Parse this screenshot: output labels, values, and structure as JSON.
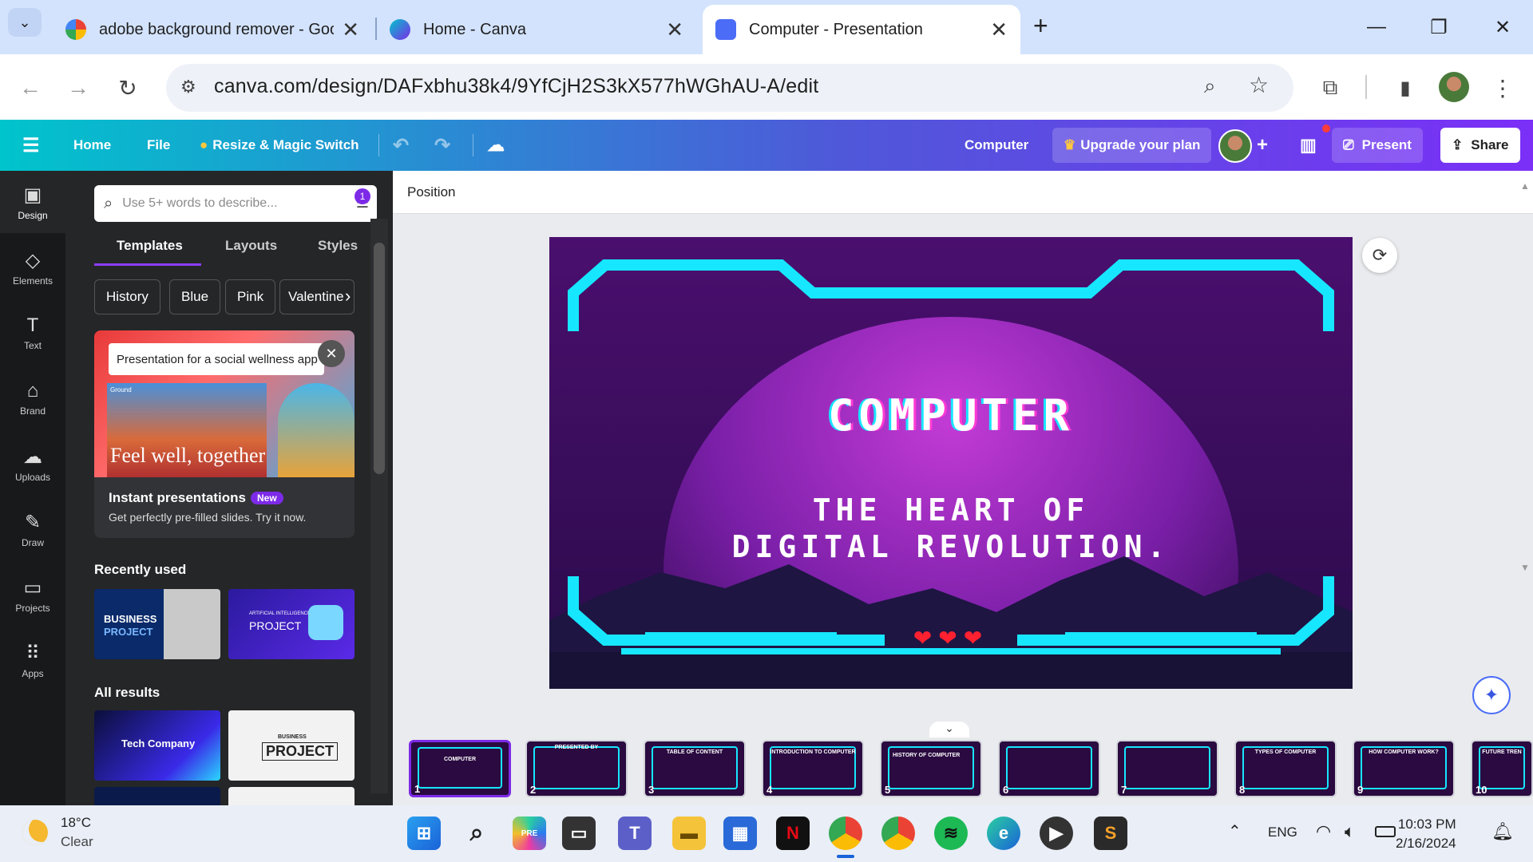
{
  "browser": {
    "tabs": [
      {
        "title": "adobe background remover - Goo",
        "icon": "google-icon",
        "active": false
      },
      {
        "title": "Home - Canva",
        "icon": "canva-icon",
        "active": false
      },
      {
        "title": "Computer - Presentation",
        "icon": "canva-presentation-icon",
        "active": true
      }
    ],
    "new_tab": "+",
    "url": "canva.com/design/DAFxbhu38k4/9YfCjH2S3kX577hWGhAU-A/edit"
  },
  "header": {
    "menu_icon": "hamburger-icon",
    "home": "Home",
    "file": "File",
    "resize": "Resize & Magic Switch",
    "doc_title": "Computer",
    "upgrade": "Upgrade your plan",
    "present": "Present",
    "share": "Share",
    "accent": "#7d2ae8"
  },
  "rail": [
    {
      "label": "Design",
      "icon": "design-icon"
    },
    {
      "label": "Elements",
      "icon": "elements-icon"
    },
    {
      "label": "Text",
      "icon": "text-icon"
    },
    {
      "label": "Brand",
      "icon": "brand-icon"
    },
    {
      "label": "Uploads",
      "icon": "uploads-icon"
    },
    {
      "label": "Draw",
      "icon": "draw-icon"
    },
    {
      "label": "Projects",
      "icon": "projects-icon"
    },
    {
      "label": "Apps",
      "icon": "apps-icon"
    }
  ],
  "panel": {
    "search_placeholder": "Use 5+ words to describe...",
    "filter_badge": "1",
    "tabs": [
      "Templates",
      "Layouts",
      "Styles"
    ],
    "chips": [
      "History",
      "Blue",
      "Pink",
      "Valentine"
    ],
    "promo": {
      "input": "Presentation for a social wellness app",
      "brand_tag": "Ground",
      "caption": "Feel well, together",
      "title": "Instant presentations",
      "badge": "New",
      "desc": "Get perfectly pre-filled slides. Try it now."
    },
    "recently_used_label": "Recently used",
    "recent": [
      {
        "line1": "BUSINESS",
        "line2": "PROJECT"
      },
      {
        "line1": "ARTIFICIAL INTELLIGENCE",
        "line2": "PROJECT"
      }
    ],
    "all_results_label": "All results",
    "results": [
      {
        "title": "Tech Company"
      },
      {
        "line1": "BUSINESS",
        "line2": "PROJECT"
      }
    ]
  },
  "workspace": {
    "position_label": "Position",
    "slide": {
      "title": "COMPUTER",
      "subtitle_line1": "THE HEART OF",
      "subtitle_line2": "DIGITAL REVOLUTION.",
      "hearts": "❤❤❤",
      "frame_color": "#17e6ff",
      "bg_color": "#3b0d5c"
    },
    "filmstrip": [
      {
        "num": "1",
        "label": "COMPUTER"
      },
      {
        "num": "2",
        "label": "PRESENTED BY"
      },
      {
        "num": "3",
        "label": "TABLE OF CONTENT"
      },
      {
        "num": "4",
        "label": "INTRODUCTION TO COMPUTER"
      },
      {
        "num": "5",
        "label": "HISTORY OF COMPUTER"
      },
      {
        "num": "6",
        "label": ""
      },
      {
        "num": "7",
        "label": ""
      },
      {
        "num": "8",
        "label": "TYPES OF COMPUTER"
      },
      {
        "num": "9",
        "label": "HOW COMPUTER WORK?"
      },
      {
        "num": "10",
        "label": "FUTURE TREN"
      }
    ]
  },
  "taskbar": {
    "temperature": "18°C",
    "condition": "Clear",
    "language": "ENG",
    "time": "10:03 PM",
    "date": "2/16/2024"
  }
}
